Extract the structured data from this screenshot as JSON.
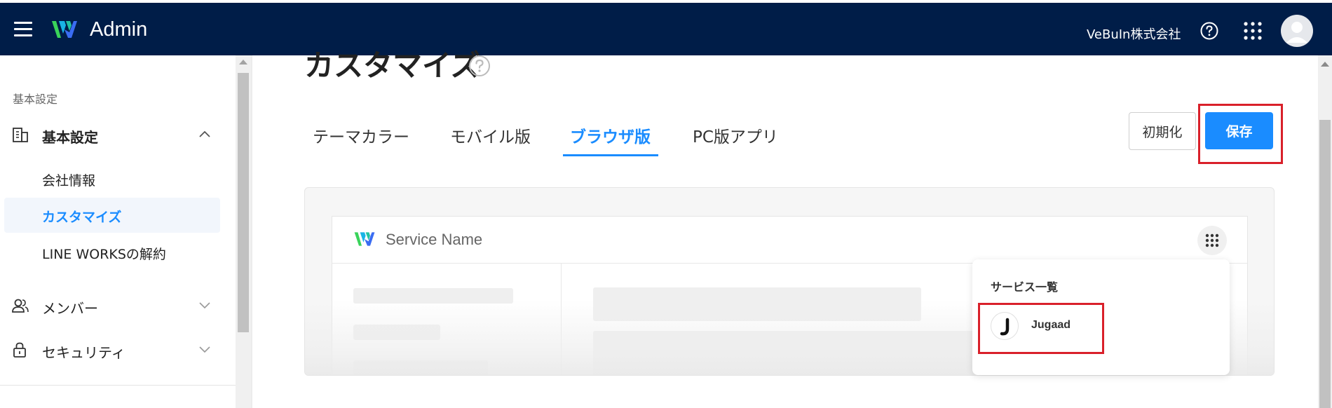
{
  "header": {
    "app_title": "Admin",
    "company": "VeBuIn株式会社",
    "bg_color": "#001d48"
  },
  "sidebar": {
    "section_label": "基本設定",
    "groups": [
      {
        "label": "基本設定",
        "icon": "building-icon",
        "expanded": true
      },
      {
        "label": "メンバー",
        "icon": "members-icon",
        "expanded": false
      },
      {
        "label": "セキュリティ",
        "icon": "lock-icon",
        "expanded": false
      }
    ],
    "items": [
      {
        "label": "会社情報",
        "active": false
      },
      {
        "label": "カスタマイズ",
        "active": true
      },
      {
        "label": "LINE WORKSの解約",
        "active": false
      }
    ]
  },
  "main": {
    "page_title": "カスタマイズ",
    "tabs": [
      {
        "label": "テーマカラー",
        "active": false
      },
      {
        "label": "モバイル版",
        "active": false
      },
      {
        "label": "ブラウザ版",
        "active": true
      },
      {
        "label": "PC版アプリ",
        "active": false
      }
    ],
    "reset_label": "初期化",
    "save_label": "保存",
    "accent_color": "#1a8cff"
  },
  "preview": {
    "service_name": "Service Name",
    "services_title": "サービス一覧",
    "service_item": "Jugaad"
  }
}
